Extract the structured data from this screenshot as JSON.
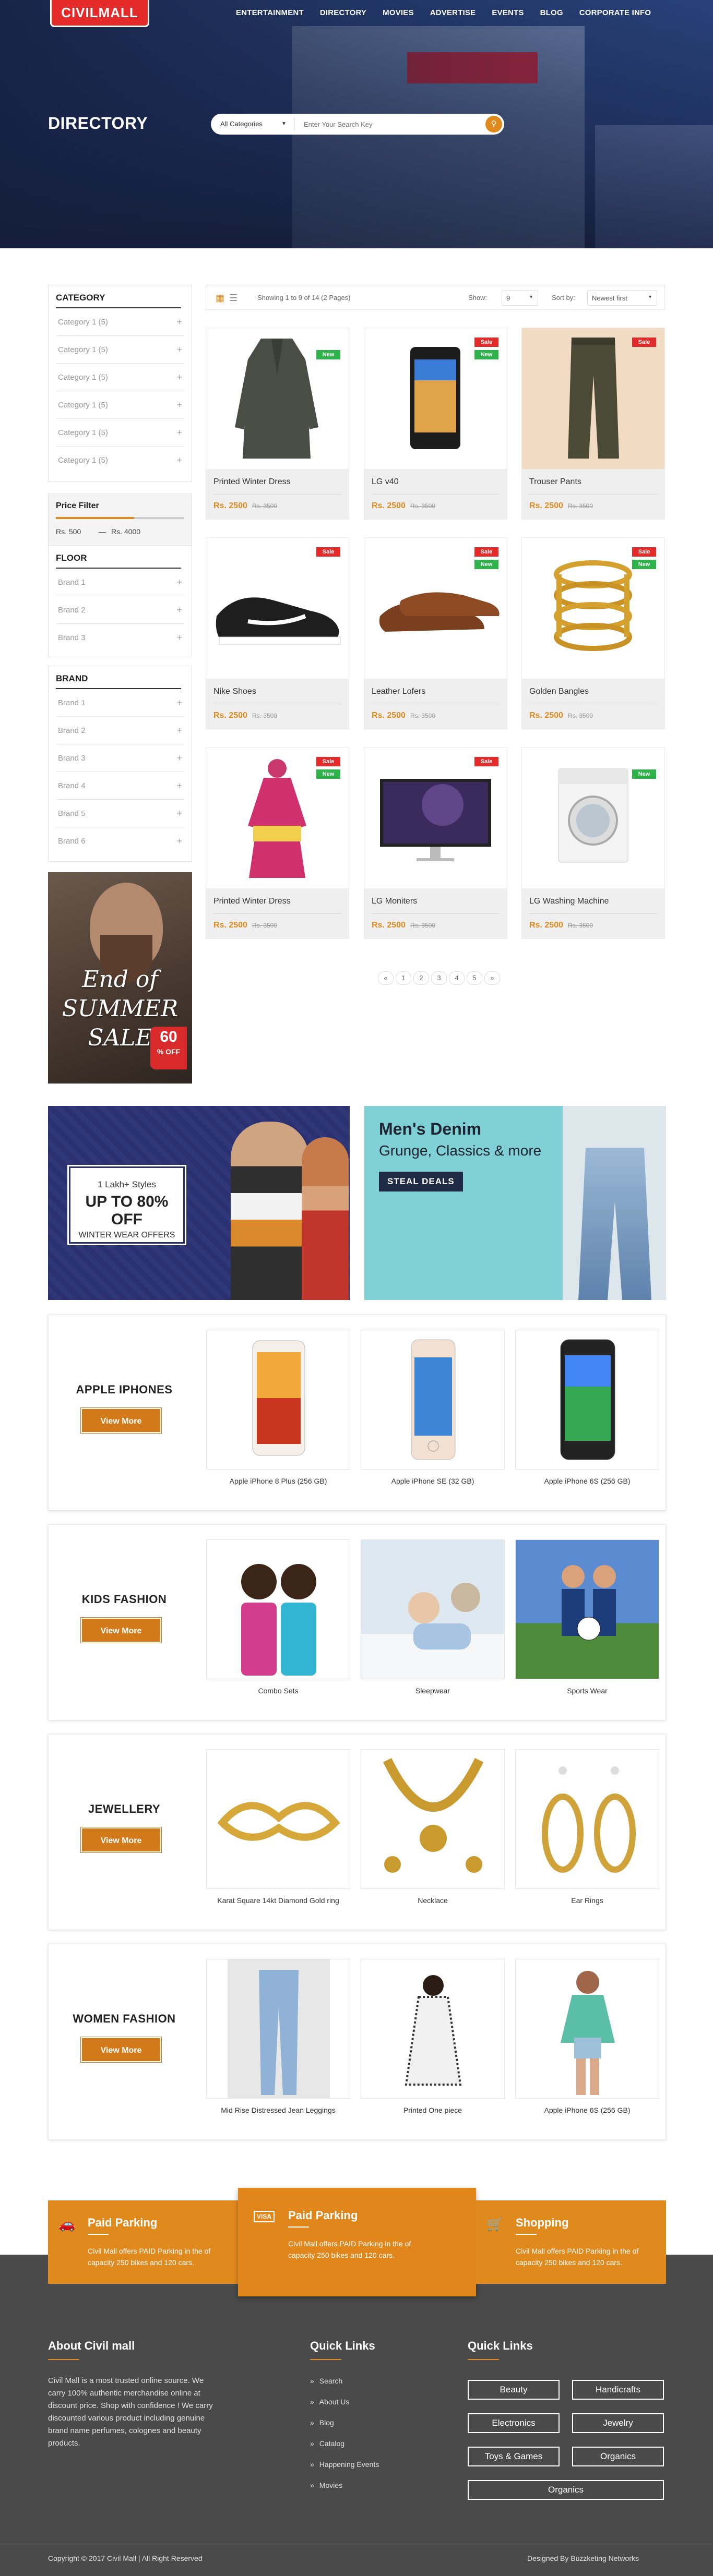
{
  "header": {
    "logo": "CIVILMALL",
    "nav": [
      "ENTERTAINMENT",
      "DIRECTORY",
      "MOVIES",
      "ADVERTISE",
      "EVENTS",
      "BLOG",
      "CORPORATE INFO"
    ],
    "page_title": "DIRECTORY",
    "search": {
      "category": "All Categories",
      "placeholder": "Enter Your Search Key"
    }
  },
  "sidebar": {
    "category_title": "CATEGORY",
    "categories": [
      "Category 1 (5)",
      "Category 1 (5)",
      "Category 1 (5)",
      "Category 1 (5)",
      "Category 1 (5)",
      "Category 1 (5)"
    ],
    "price_filter": {
      "title": "Price Filter",
      "min": "Rs. 500",
      "sep": "—",
      "max": "Rs. 4000"
    },
    "floor_title": "FLOOR",
    "floors": [
      "Brand 1",
      "Brand 2",
      "Brand 3"
    ],
    "brand_title": "BRAND",
    "brands": [
      "Brand 1",
      "Brand 2",
      "Brand 3",
      "Brand 4",
      "Brand 5",
      "Brand 6"
    ],
    "banner": {
      "line1": "End of",
      "line2": "SUMMER",
      "line3": "SALE",
      "pct": "60",
      "off": "% OFF"
    }
  },
  "toolbar": {
    "showing": "Showing 1 to 9 of 14 (2 Pages)",
    "show_label": "Show:",
    "show_value": "9",
    "sort_label": "Sort by:",
    "sort_value": "Newest first"
  },
  "products": [
    {
      "name": "Printed Winter Dress",
      "price": "Rs. 2500",
      "old": "Rs. 3500",
      "tags": [
        "New"
      ]
    },
    {
      "name": "LG v40",
      "price": "Rs. 2500",
      "old": "Rs. 3500",
      "tags": [
        "Sale",
        "New"
      ]
    },
    {
      "name": "Trouser Pants",
      "price": "Rs. 2500",
      "old": "Rs. 3500",
      "tags": [
        "Sale"
      ]
    },
    {
      "name": "Nike Shoes",
      "price": "Rs. 2500",
      "old": "Rs. 3500",
      "tags": [
        "Sale"
      ]
    },
    {
      "name": "Leather Lofers",
      "price": "Rs. 2500",
      "old": "Rs. 3500",
      "tags": [
        "Sale",
        "New"
      ]
    },
    {
      "name": "Golden Bangles",
      "price": "Rs. 2500",
      "old": "Rs. 3500",
      "tags": [
        "Sale",
        "New"
      ]
    },
    {
      "name": "Printed Winter Dress",
      "price": "Rs. 2500",
      "old": "Rs. 3500",
      "tags": [
        "Sale",
        "New"
      ]
    },
    {
      "name": "LG Moniters",
      "price": "Rs. 2500",
      "old": "Rs. 3500",
      "tags": [
        "Sale"
      ]
    },
    {
      "name": "LG Washing Machine",
      "price": "Rs. 2500",
      "old": "Rs. 3500",
      "tags": [
        "New"
      ]
    }
  ],
  "pagination": [
    "«",
    "1",
    "2",
    "3",
    "4",
    "5",
    "»"
  ],
  "promos": {
    "winter": {
      "line1": "1 Lakh+ Styles",
      "line2": "UP TO 80% OFF",
      "line3": "WINTER WEAR OFFERS"
    },
    "denim": {
      "title": "Men's Denim",
      "subtitle": "Grunge, Classics & more",
      "button": "STEAL DEALS"
    }
  },
  "categories": [
    {
      "title": "APPLE IPHONES",
      "button": "View More",
      "items": [
        "Apple iPhone 8 Plus (256 GB)",
        "Apple iPhone SE (32 GB)",
        "Apple iPhone 6S (256 GB)"
      ]
    },
    {
      "title": "KIDS FASHION",
      "button": "View More",
      "items": [
        "Combo Sets",
        "Sleepwear",
        "Sports Wear"
      ]
    },
    {
      "title": "JEWELLERY",
      "button": "View More",
      "items": [
        "Karat Square 14kt Diamond Gold ring",
        "Necklace",
        "Ear Rings"
      ]
    },
    {
      "title": "WOMEN FASHION",
      "button": "View More",
      "items": [
        "Mid Rise Distressed Jean Leggings",
        "Printed One piece",
        "Apple iPhone 6S (256 GB)"
      ]
    }
  ],
  "features": [
    {
      "title": "Paid Parking",
      "desc": "Civil Mall offers PAID Parking in the of capacity 250 bikes and 120 cars.",
      "icon": "car-icon"
    },
    {
      "title": "Paid Parking",
      "desc": "Civil Mall offers PAID Parking in the of capacity 250 bikes and 120 cars.",
      "icon": "visa-icon",
      "icon_text": "VISA"
    },
    {
      "title": "Shopping",
      "desc": "Civil Mall offers PAID Parking in the of capacity 250 bikes and 120 cars.",
      "icon": "cart-icon"
    }
  ],
  "footer": {
    "about_title": "About Civil mall",
    "about_text": "Civil Mall is a most trusted online source. We carry 100% authentic merchandise online at discount price. Shop with confidence ! We carry discounted various product including genuine brand name perfumes, colognes and beauty products.",
    "quick1_title": "Quick Links",
    "quick1": [
      "Search",
      "About Us",
      "Blog",
      "Catalog",
      "Happening Events",
      "Movies"
    ],
    "quick2_title": "Quick Links",
    "quick2": [
      "Beauty",
      "Handicrafts",
      "Electronics",
      "Jewelry",
      "Toys & Games",
      "Organics",
      "Organics"
    ],
    "copyright": "Copyright © 2017 Civil Mall | All Right Reserved",
    "designed": "Designed By Buzzketing Networks"
  },
  "colors": {
    "accent": "#e08a1d",
    "sale": "#e52a2a",
    "new": "#2db34a",
    "footer": "#4a4a4a"
  }
}
